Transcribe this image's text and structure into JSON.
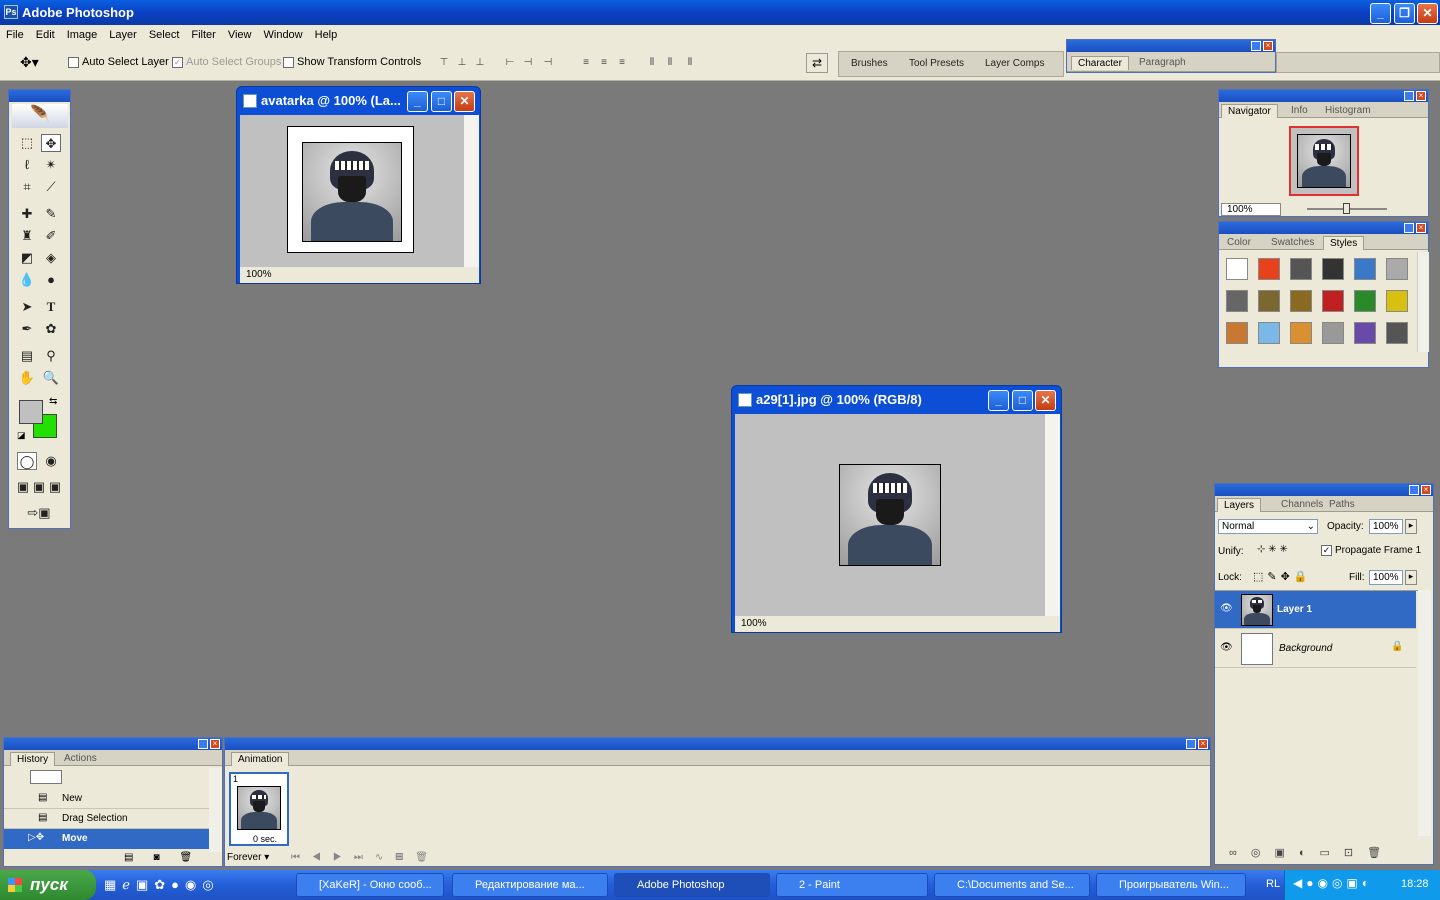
{
  "app": {
    "title": "Adobe Photoshop"
  },
  "menu": [
    "File",
    "Edit",
    "Image",
    "Layer",
    "Select",
    "Filter",
    "View",
    "Window",
    "Help"
  ],
  "options": {
    "auto_select_layer": "Auto Select Layer",
    "auto_select_groups": "Auto Select Groups",
    "show_transform": "Show Transform Controls",
    "palette_tabs": [
      "Brushes",
      "Tool Presets",
      "Layer Comps"
    ],
    "char_tabs": [
      "Character",
      "Paragraph"
    ]
  },
  "doc1": {
    "title": "avatarka @ 100% (La...",
    "zoom": "100%"
  },
  "doc2": {
    "title": "a29[1].jpg @ 100% (RGB/8)",
    "zoom": "100%"
  },
  "navigator": {
    "tabs": [
      "Navigator",
      "Info",
      "Histogram"
    ],
    "zoom": "100%"
  },
  "styles": {
    "tabs": [
      "Color",
      "Swatches",
      "Styles"
    ]
  },
  "layers": {
    "tabs": [
      "Layers",
      "Channels",
      "Paths"
    ],
    "blend": "Normal",
    "opacity_label": "Opacity:",
    "opacity": "100%",
    "unify_label": "Unify:",
    "propagate": "Propagate Frame 1",
    "lock_label": "Lock:",
    "fill_label": "Fill:",
    "fill": "100%",
    "items": [
      "Layer 1",
      "Background"
    ]
  },
  "history": {
    "tabs": [
      "History",
      "Actions"
    ],
    "items": [
      "New",
      "Drag Selection",
      "Move"
    ]
  },
  "animation": {
    "tab": "Animation",
    "frame_num": "1",
    "frame_delay": "0 sec.",
    "loop": "Forever"
  },
  "taskbar": {
    "start": "пуск",
    "tasks": [
      "[XaKeR] - Окно сооб...",
      "Редактирование ма...",
      "Adobe Photoshop",
      "2 - Paint",
      "C:\\Documents and Se...",
      "Проигрыватель Win..."
    ],
    "lang": "RL",
    "clock": "18:28"
  },
  "colors": {
    "foreground": "#c0c0c0",
    "background": "#22e000",
    "workspace": "#7a7a7a"
  }
}
